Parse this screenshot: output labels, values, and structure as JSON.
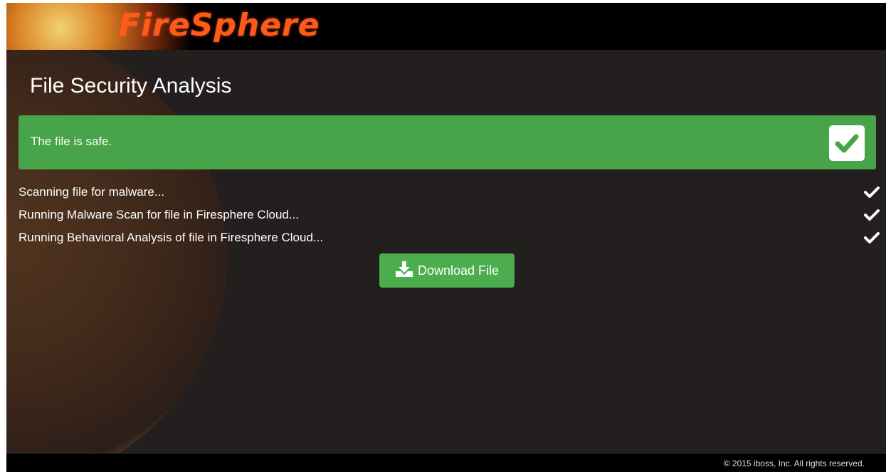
{
  "brand": {
    "logo_text": "FireSphere"
  },
  "page": {
    "title": "File Security Analysis"
  },
  "result": {
    "message": "The file is safe.",
    "status": "safe",
    "icon": "check-square-icon",
    "color": "#47a448"
  },
  "steps": [
    {
      "label": "Scanning file for malware...",
      "status_icon": "check-icon"
    },
    {
      "label": "Running Malware Scan for file in Firesphere Cloud...",
      "status_icon": "check-icon"
    },
    {
      "label": "Running Behavioral Analysis of file in Firesphere Cloud...",
      "status_icon": "check-icon"
    }
  ],
  "actions": {
    "download_label": "Download File",
    "download_icon": "download-icon"
  },
  "footer": {
    "copyright": "© 2015 iboss, Inc. All rights reserved."
  }
}
